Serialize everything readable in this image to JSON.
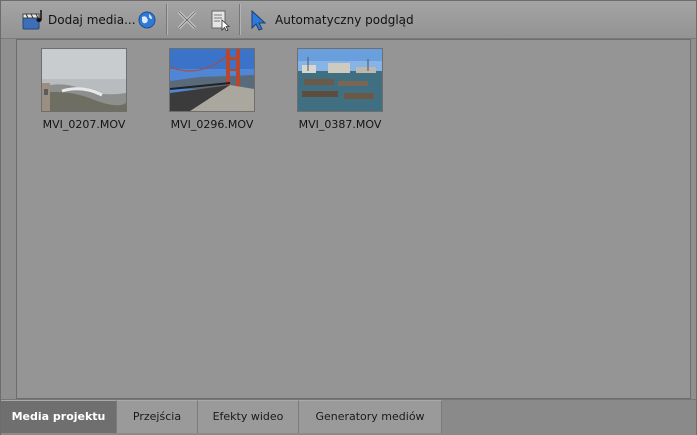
{
  "toolbar": {
    "add_media_label": "Dodaj media...",
    "auto_preview_label": "Automatyczny podgląd",
    "icons": [
      "add-media-icon",
      "globe-icon",
      "delete-x-icon",
      "properties-icon",
      "auto-preview-cursor-icon"
    ]
  },
  "media": [
    {
      "name": "MVI_0207.MOV",
      "thumb": "foggy-coast"
    },
    {
      "name": "MVI_0296.MOV",
      "thumb": "golden-gate-bridge-walkway"
    },
    {
      "name": "MVI_0387.MOV",
      "thumb": "pier-with-boats"
    }
  ],
  "tabs": [
    {
      "label": "Media projektu",
      "active": true
    },
    {
      "label": "Przejścia",
      "active": false
    },
    {
      "label": "Efekty wideo",
      "active": false
    },
    {
      "label": "Generatory mediów",
      "active": false
    }
  ],
  "colors": {
    "accent_blue": "#2f7ad8",
    "active_tab": "#6f6f6f"
  }
}
